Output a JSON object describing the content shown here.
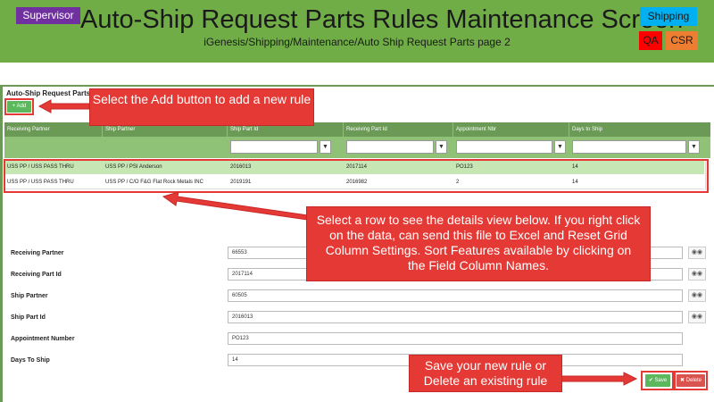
{
  "banner": {
    "role_tag": "Supervisor",
    "title": "Auto-Ship Request Parts Rules Maintenance Screen",
    "breadcrumb": "iGenesis/Shipping/Maintenance/Auto Ship Request Parts page 2",
    "tags": {
      "shipping": "Shipping",
      "qa": "QA",
      "csr": "CSR"
    }
  },
  "section_title": "Auto-Ship Request Parts",
  "add_button": "+ Add",
  "grid": {
    "columns": [
      "Receiving Partner",
      "Ship Partner",
      "Ship Part Id",
      "Receiving Part Id",
      "Appointment Nbr",
      "Days to Ship"
    ],
    "filter_icon": "filter-icon",
    "rows": [
      {
        "receiving_partner": "USS PP / USS PASS THRU",
        "ship_partner": "USS PP / PSI Anderson",
        "ship_part_id": "2016013",
        "receiving_part_id": "2017114",
        "appointment_nbr": "PO123",
        "days_to_ship": "14"
      },
      {
        "receiving_partner": "USS PP / USS PASS THRU",
        "ship_partner": "USS PP / C/O F&G Flat Rock Metals INC",
        "ship_part_id": "2019191",
        "receiving_part_id": "2016982",
        "appointment_nbr": "2",
        "days_to_ship": "14"
      }
    ]
  },
  "details": {
    "receiving_partner": {
      "label": "Receiving Partner",
      "value": "66553"
    },
    "receiving_part_id": {
      "label": "Receiving Part Id",
      "value": "2017114"
    },
    "ship_partner": {
      "label": "Ship Partner",
      "value": "60505"
    },
    "ship_part_id": {
      "label": "Ship Part Id",
      "value": "2016013"
    },
    "appointment_number": {
      "label": "Appointment Number",
      "value": "PO123"
    },
    "days_to_ship": {
      "label": "Days To Ship",
      "value": "14"
    },
    "lookup_icon": "binoculars-icon"
  },
  "buttons": {
    "save": "✔ Save",
    "delete": "✖ Delete"
  },
  "callouts": {
    "add": "Select the Add button to add a new rule",
    "row": "Select a row to see the details view below. If you right click on the data, can send this file to Excel and Reset Grid Column Settings. Sort Features available by clicking on the Field Column Names.",
    "save": "Save your new rule or Delete an existing rule"
  },
  "colors": {
    "banner": "#70ad47",
    "grid_header": "#6a9a55",
    "callout": "#e53935",
    "selected_row": "#c6e6b4"
  }
}
